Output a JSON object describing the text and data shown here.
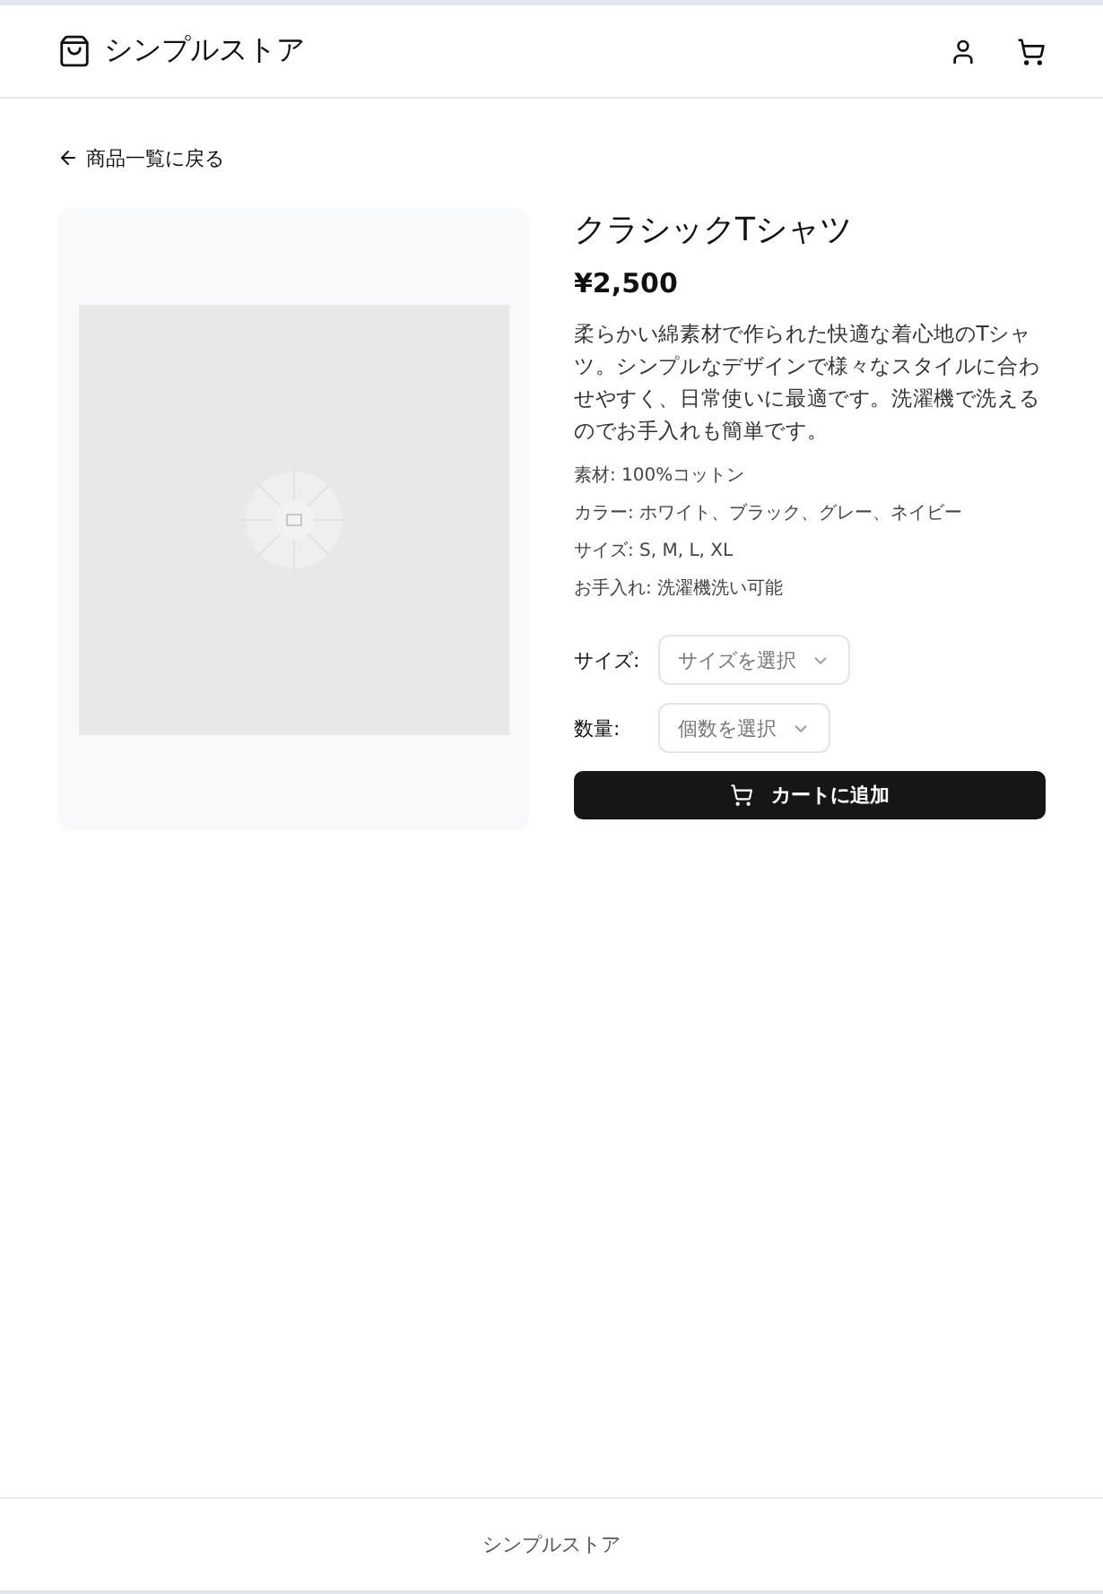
{
  "header": {
    "store_name": "シンプルストア"
  },
  "back_link": "商品一覧に戻る",
  "product": {
    "title": "クラシックTシャツ",
    "price": "¥2,500",
    "description": "柔らかい綿素材で作られた快適な着心地のTシャツ。シンプルなデザインで様々なスタイルに合わせやすく、日常使いに最適です。洗濯機で洗えるのでお手入れも簡単です。",
    "specs": [
      "素材: 100%コットン",
      "カラー: ホワイト、ブラック、グレー、ネイビー",
      "サイズ: S, M, L, XL",
      "お手入れ: 洗濯機洗い可能"
    ],
    "options": [
      {
        "label": "サイズ:",
        "placeholder": "サイズを選択"
      },
      {
        "label": "数量:",
        "placeholder": "個数を選択"
      }
    ],
    "add_to_cart": "カートに追加"
  },
  "footer": {
    "text": "シンプルストア"
  }
}
